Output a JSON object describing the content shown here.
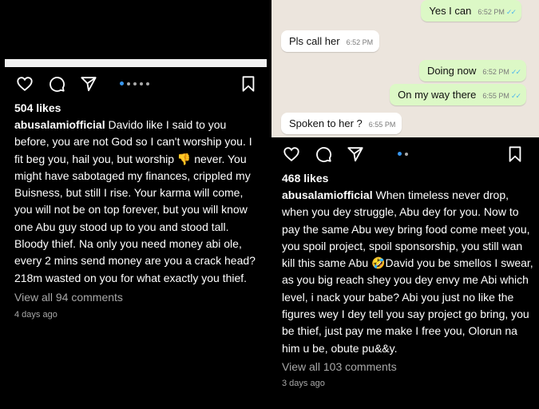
{
  "left_post": {
    "likes": "504 likes",
    "username": "abusalamiofficial",
    "caption": "Davido like I said to you before, you are not God so I can't worship you. I fit beg you, hail you, but worship 👎 never. You might have sabotaged my finances, crippled my Buisness, but still I rise. Your karma will come, you will not be on top forever, but you will know one Abu guy stood up to you and stood tall. Bloody thief. Na only you need money abi ole, every 2 mins send money are you a crack head?  218m wasted on you for what exactly you thief.",
    "view_comments": "View all 94 comments",
    "time_ago": "4 days ago",
    "carousel_dots": 5,
    "active_dot": 0
  },
  "chat": {
    "messages": [
      {
        "text": "Yes I can",
        "time": "6:52 PM",
        "dir": "out",
        "read": true
      },
      {
        "text": "Pls call her",
        "time": "6:52 PM",
        "dir": "in"
      },
      {
        "text": "Doing now",
        "time": "6:52 PM",
        "dir": "out",
        "read": true
      },
      {
        "text": "On my way there",
        "time": "6:55 PM",
        "dir": "out",
        "read": true
      },
      {
        "text": "Spoken to her ?",
        "time": "6:55 PM",
        "dir": "in"
      }
    ]
  },
  "right_post": {
    "likes": "468 likes",
    "username": "abusalamiofficial",
    "caption": "When timeless never drop, when you dey struggle, Abu dey for you. Now to pay the same Abu wey bring food come meet you, you spoil project, spoil sponsorship, you still wan kill this same Abu 🤣David you be smellos I swear, as you big reach shey you dey envy me Abi which level, i nack your babe? Abi you just no like the figures wey I dey tell you say project go bring, you be thief, just pay me make I free you, Olorun na him u be, obute pu&&y.",
    "view_comments": "View all 103 comments",
    "time_ago": "3 days ago",
    "carousel_dots": 2,
    "active_dot": 0
  },
  "icons": [
    "heart-icon",
    "comment-icon",
    "share-icon",
    "bookmark-icon"
  ],
  "colors": {
    "background": "#000000",
    "chat_bg": "#ece5dd",
    "bubble_out": "#dcf8c6",
    "bubble_in": "#ffffff",
    "dot_active": "#3897f0",
    "read_ticks": "#4fb6ec"
  }
}
